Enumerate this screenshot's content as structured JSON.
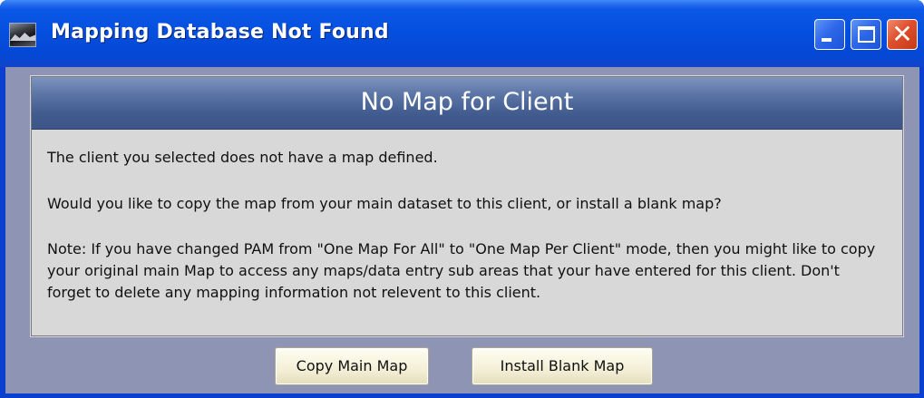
{
  "window": {
    "title": "Mapping Database Not Found",
    "icon": "mountain-app-icon",
    "controls": {
      "minimize": "minimize-icon",
      "maximize": "maximize-icon",
      "close_glyph": "✕"
    }
  },
  "panel": {
    "heading": "No Map for Client",
    "message1": "The client you selected does not have a map defined.",
    "message2": "Would you like to copy the map from your main dataset to this client, or install a blank map?",
    "message3": "Note: If you have changed PAM from \"One Map For All\" to \"One Map Per Client\" mode, then you might like to copy your original main Map to access any maps/data entry sub areas that your have entered for this client. Don't forget to delete any mapping information not relevent to this client."
  },
  "buttons": {
    "copy_label": "Copy Main Map",
    "install_label": "Install Blank Map"
  },
  "colors": {
    "titlebar": "#0650df",
    "client_background": "#8e94b4",
    "panel_header": "#4a6498",
    "panel_body": "#d8d8d8",
    "close_button": "#df4f2c"
  }
}
